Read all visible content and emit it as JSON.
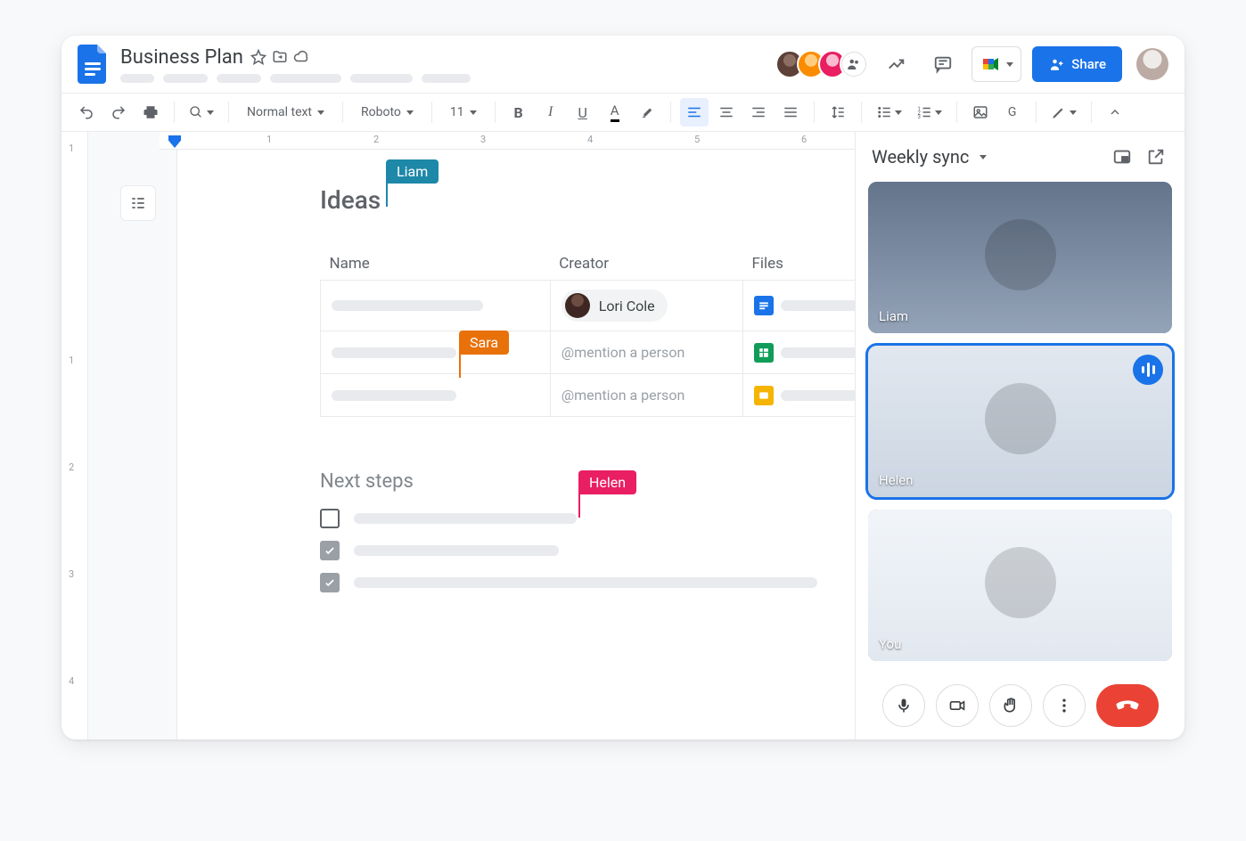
{
  "doc": {
    "title": "Business Plan"
  },
  "toolbar": {
    "style": "Normal text",
    "font": "Roboto",
    "size": "11"
  },
  "share": {
    "label": "Share"
  },
  "ruler": {
    "marks": [
      "1",
      "2",
      "3",
      "4",
      "5",
      "6"
    ]
  },
  "vruler": {
    "marks": [
      "1",
      "1",
      "2",
      "3",
      "4"
    ]
  },
  "content": {
    "heading1": "Ideas",
    "heading2": "Next steps",
    "cursors": {
      "liam": "Liam",
      "sara": "Sara",
      "helen": "Helen"
    },
    "table": {
      "headers": {
        "name": "Name",
        "creator": "Creator",
        "files": "Files"
      },
      "rows": [
        {
          "creator_chip": "Lori Cole",
          "file_type": "doc"
        },
        {
          "creator_placeholder": "@mention a person",
          "file_type": "sheet"
        },
        {
          "creator_placeholder": "@mention a person",
          "file_type": "slide"
        }
      ]
    },
    "checklist": [
      {
        "checked": false
      },
      {
        "checked": true
      },
      {
        "checked": true
      }
    ]
  },
  "meet": {
    "title": "Weekly sync",
    "participants": [
      {
        "name": "Liam",
        "speaking": false
      },
      {
        "name": "Helen",
        "speaking": true
      },
      {
        "name": "You",
        "speaking": false
      }
    ]
  }
}
